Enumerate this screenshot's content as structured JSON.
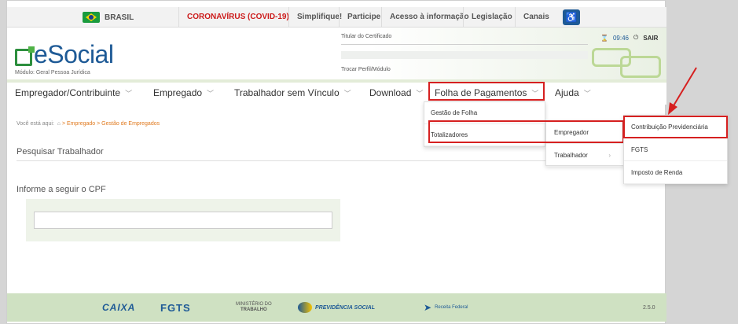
{
  "gov_bar": {
    "country": "BRASIL",
    "covid": "CORONAVÍRUS (COVID-19)",
    "simplifique": "Simplifique!",
    "participe": "Participe",
    "acesso": "Acesso à informação",
    "legislacao": "Legislação",
    "canais": "Canais"
  },
  "header": {
    "logo": "eSocial",
    "modulo": "Módulo: Geral Pessoa Jurídica",
    "titular_label": "Titular do Certificado",
    "trocar": "Trocar Perfil/Módulo",
    "time": "09:46",
    "sair": "SAIR"
  },
  "nav": {
    "items": [
      "Empregador/Contribuinte",
      "Empregado",
      "Trabalhador sem Vínculo",
      "Download",
      "Folha de Pagamentos",
      "Ajuda"
    ]
  },
  "menu_folha": [
    "Gestão de Folha",
    "Totalizadores"
  ],
  "menu_totalizadores": [
    "Empregador",
    "Trabalhador"
  ],
  "menu_empregador": [
    "Contribuição Previdenciária",
    "FGTS",
    "Imposto de Renda"
  ],
  "breadcrumb": {
    "prefix": "Você está aqui:",
    "path": "> Empregado > Gestão de Empregados"
  },
  "content": {
    "section_title": "Pesquisar Trabalhador",
    "cpf_label": "Informe a seguir o CPF",
    "cpf_value": ""
  },
  "footer": {
    "caixa": "CAIXA",
    "fgts": "FGTS",
    "mt1": "MINISTÉRIO DO",
    "mt2": "TRABALHO",
    "previdencia": "PREVIDÊNCIA SOCIAL",
    "rf": "Receita Federal",
    "version": "2.5.0"
  },
  "colors": {
    "brand_blue": "#1e5a96",
    "brand_green": "#2d8f3e",
    "highlight_red": "#d62020",
    "covid_red": "#cc1a1a"
  }
}
